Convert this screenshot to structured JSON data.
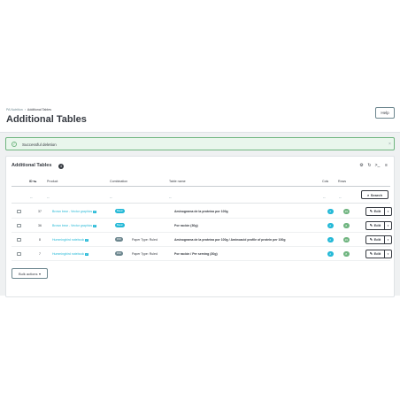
{
  "breadcrumb": {
    "parent": "PA Nutrition",
    "current": "Additional Tables"
  },
  "header": {
    "title": "Additional Tables",
    "help_label": "Help"
  },
  "alert": {
    "message": "Successful deletion",
    "close": "×",
    "icon": "check-icon"
  },
  "grid": {
    "title": "Additional Tables",
    "count": "4",
    "columns": {
      "id": "ID ▾▴",
      "product": "Product",
      "combination": "Combination",
      "table_name": "Table name",
      "cols": "Cols",
      "rows": "Rows"
    },
    "filter_placeholder": "--",
    "search_label": "Search",
    "rows": [
      {
        "id": "37",
        "product": "Brown bear - Vector graphics",
        "combination_badge": "Basic",
        "combination_text": "",
        "table_name": "Aminograma de la proteína por 100g",
        "cols": "2",
        "rows": "19"
      },
      {
        "id": "36",
        "product": "Brown bear - Vector graphics",
        "combination_badge": "Basic",
        "combination_text": "",
        "table_name": "Por ración (30g)",
        "cols": "2",
        "rows": "8"
      },
      {
        "id": "8",
        "product": "Hummingbird notebook",
        "combination_badge": "#19",
        "combination_text": "Paper Type: Ruled",
        "table_name": "Aminograma de la proteína por 100g / Aminoacid profile of protein per 100g",
        "cols": "2",
        "rows": "19"
      },
      {
        "id": "7",
        "product": "Hummingbird notebook",
        "combination_badge": "#19",
        "combination_text": "Paper Type: Ruled",
        "table_name": "Por ración / Per serving (30g)",
        "cols": "2",
        "rows": "8"
      }
    ],
    "edit_label": "Edit",
    "bulk_label": "Bulk actions"
  },
  "colors": {
    "accent": "#25b9d7",
    "success": "#70b580",
    "text": "#363a41"
  }
}
